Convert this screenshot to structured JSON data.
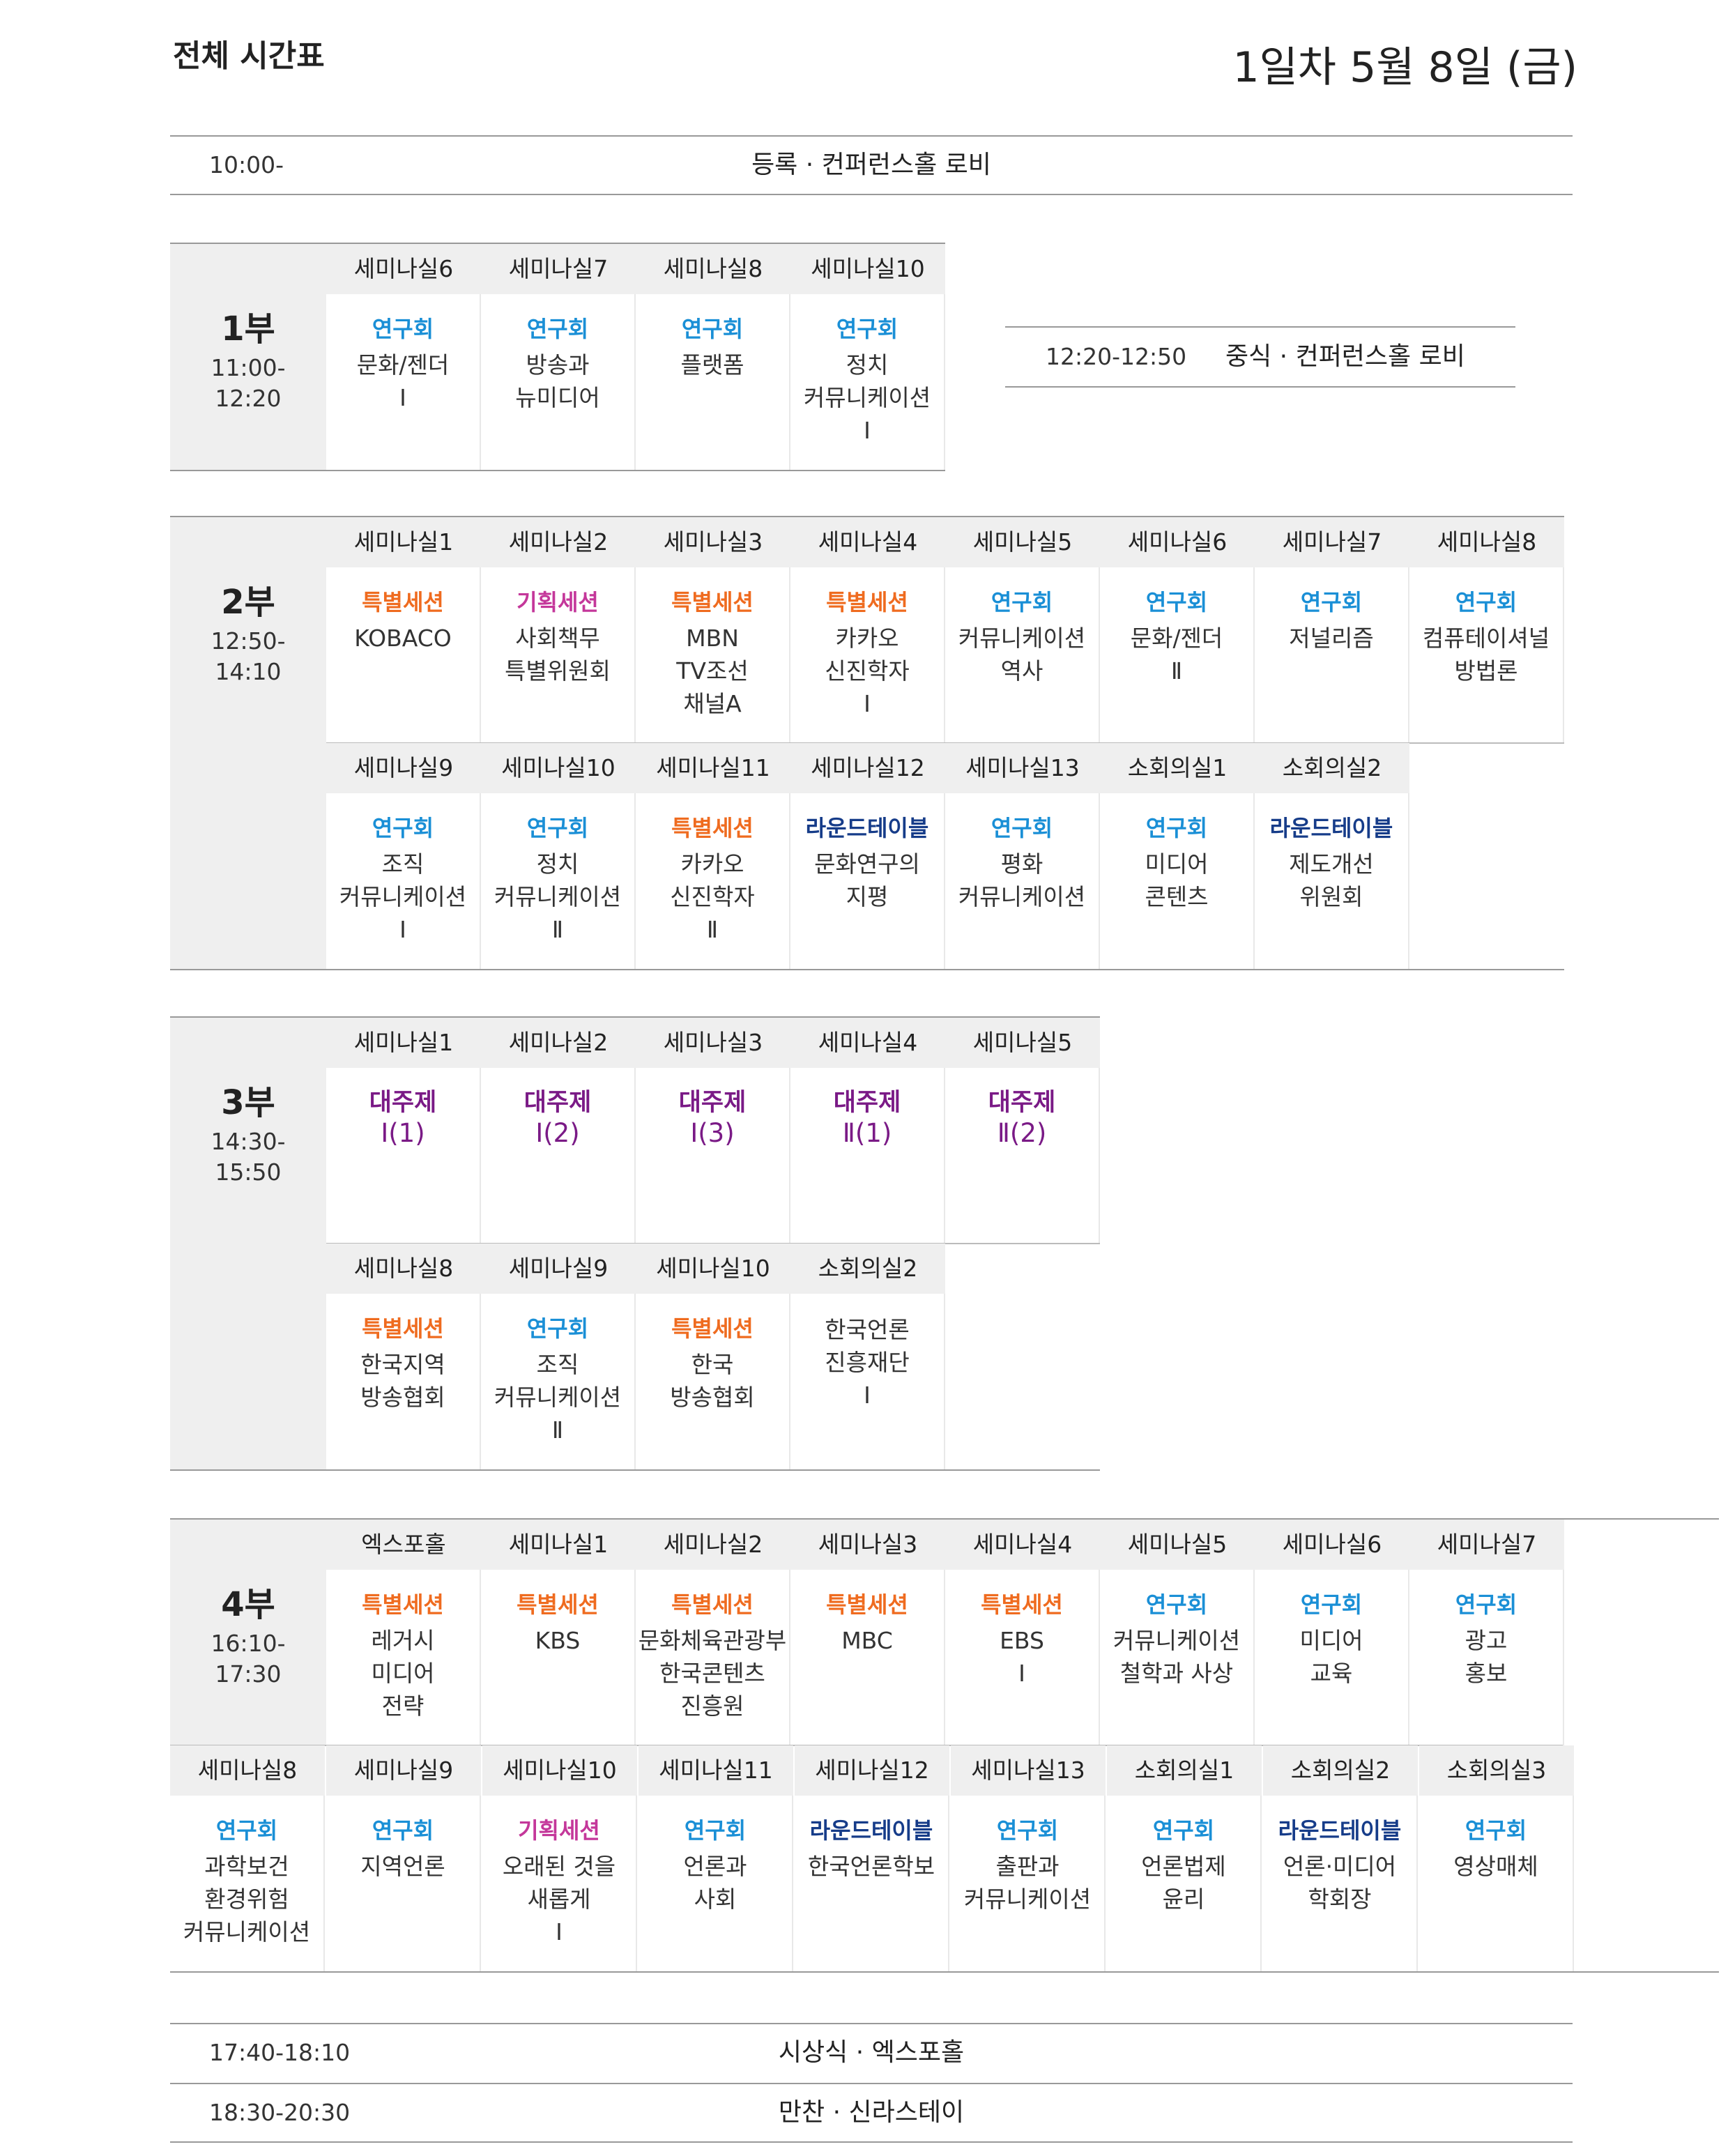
{
  "header": {
    "title": "전체 시간표",
    "date": "1일차 5월 8일 (금)"
  },
  "colors": {
    "study": "#1a8fd6",
    "special": "#ef6b1f",
    "planning": "#c4379a",
    "roundtable": "#163c89",
    "theme": "#7a1a86",
    "header_bg": "#efefef"
  },
  "registration": {
    "time": "10:00-",
    "event": "등록 · 컨퍼런스홀 로비"
  },
  "lunch": {
    "time": "12:20-12:50",
    "event": "중식 · 컨퍼런스홀 로비"
  },
  "parts": [
    {
      "name": "1부",
      "time_start": "11:00-",
      "time_end": "12:20",
      "rows": [
        [
          {
            "room": "세미나실6",
            "cat": "연구회",
            "lines": [
              "문화/젠더",
              "Ⅰ"
            ]
          },
          {
            "room": "세미나실7",
            "cat": "연구회",
            "lines": [
              "방송과",
              "뉴미디어"
            ]
          },
          {
            "room": "세미나실8",
            "cat": "연구회",
            "lines": [
              "플랫폼"
            ]
          },
          {
            "room": "세미나실10",
            "cat": "연구회",
            "lines": [
              "정치",
              "커뮤니케이션",
              "Ⅰ"
            ]
          }
        ]
      ]
    },
    {
      "name": "2부",
      "time_start": "12:50-",
      "time_end": "14:10",
      "rows": [
        [
          {
            "room": "세미나실1",
            "cat": "특별세션",
            "lines": [
              "KOBACO"
            ]
          },
          {
            "room": "세미나실2",
            "cat": "기획세션",
            "lines": [
              "사회책무",
              "특별위원회"
            ]
          },
          {
            "room": "세미나실3",
            "cat": "특별세션",
            "lines": [
              "MBN",
              "TV조선",
              "채널A"
            ]
          },
          {
            "room": "세미나실4",
            "cat": "특별세션",
            "lines": [
              "카카오",
              "신진학자",
              "Ⅰ"
            ]
          },
          {
            "room": "세미나실5",
            "cat": "연구회",
            "lines": [
              "커뮤니케이션",
              "역사"
            ]
          },
          {
            "room": "세미나실6",
            "cat": "연구회",
            "lines": [
              "문화/젠더",
              "Ⅱ"
            ]
          },
          {
            "room": "세미나실7",
            "cat": "연구회",
            "lines": [
              "저널리즘"
            ]
          },
          {
            "room": "세미나실8",
            "cat": "연구회",
            "lines": [
              "컴퓨테이셔널",
              "방법론"
            ]
          }
        ],
        [
          {
            "room": "세미나실9",
            "cat": "연구회",
            "lines": [
              "조직",
              "커뮤니케이션",
              "Ⅰ"
            ]
          },
          {
            "room": "세미나실10",
            "cat": "연구회",
            "lines": [
              "정치",
              "커뮤니케이션",
              "Ⅱ"
            ]
          },
          {
            "room": "세미나실11",
            "cat": "특별세션",
            "lines": [
              "카카오",
              "신진학자",
              "Ⅱ"
            ]
          },
          {
            "room": "세미나실12",
            "cat": "라운드테이블",
            "lines": [
              "문화연구의",
              "지평"
            ]
          },
          {
            "room": "세미나실13",
            "cat": "연구회",
            "lines": [
              "평화",
              "커뮤니케이션"
            ]
          },
          {
            "room": "소회의실1",
            "cat": "연구회",
            "lines": [
              "미디어",
              "콘텐츠"
            ]
          },
          {
            "room": "소회의실2",
            "cat": "라운드테이블",
            "lines": [
              "제도개선",
              "위원회"
            ]
          }
        ]
      ]
    },
    {
      "name": "3부",
      "time_start": "14:30-",
      "time_end": "15:50",
      "rows": [
        [
          {
            "room": "세미나실1",
            "cat": "대주제",
            "lines": [
              "Ⅰ(1)"
            ]
          },
          {
            "room": "세미나실2",
            "cat": "대주제",
            "lines": [
              "Ⅰ(2)"
            ]
          },
          {
            "room": "세미나실3",
            "cat": "대주제",
            "lines": [
              "Ⅰ(3)"
            ]
          },
          {
            "room": "세미나실4",
            "cat": "대주제",
            "lines": [
              "Ⅱ(1)"
            ]
          },
          {
            "room": "세미나실5",
            "cat": "대주제",
            "lines": [
              "Ⅱ(2)"
            ]
          }
        ],
        [
          {
            "room": "세미나실8",
            "cat": "특별세션",
            "lines": [
              "한국지역",
              "방송협회"
            ]
          },
          {
            "room": "세미나실9",
            "cat": "연구회",
            "lines": [
              "조직",
              "커뮤니케이션",
              "Ⅱ"
            ]
          },
          {
            "room": "세미나실10",
            "cat": "특별세션",
            "lines": [
              "한국",
              "방송협회"
            ]
          },
          {
            "room": "소회의실2",
            "cat": "",
            "lines": [
              "한국언론",
              "진흥재단",
              "Ⅰ"
            ]
          }
        ]
      ]
    },
    {
      "name": "4부",
      "time_start": "16:10-",
      "time_end": "17:30",
      "rows": [
        [
          {
            "room": "엑스포홀",
            "cat": "특별세션",
            "lines": [
              "레거시",
              "미디어",
              "전략"
            ]
          },
          {
            "room": "세미나실1",
            "cat": "특별세션",
            "lines": [
              "KBS"
            ]
          },
          {
            "room": "세미나실2",
            "cat": "특별세션",
            "lines": [
              "문화체육관광부",
              "한국콘텐츠",
              "진흥원"
            ]
          },
          {
            "room": "세미나실3",
            "cat": "특별세션",
            "lines": [
              "MBC"
            ]
          },
          {
            "room": "세미나실4",
            "cat": "특별세션",
            "lines": [
              "EBS",
              "Ⅰ"
            ]
          },
          {
            "room": "세미나실5",
            "cat": "연구회",
            "lines": [
              "커뮤니케이션",
              "철학과 사상"
            ]
          },
          {
            "room": "세미나실6",
            "cat": "연구회",
            "lines": [
              "미디어",
              "교육"
            ]
          },
          {
            "room": "세미나실7",
            "cat": "연구회",
            "lines": [
              "광고",
              "홍보"
            ]
          }
        ],
        [
          {
            "room": "세미나실8",
            "cat": "연구회",
            "lines": [
              "과학보건",
              "환경위험",
              "커뮤니케이션"
            ]
          },
          {
            "room": "세미나실9",
            "cat": "연구회",
            "lines": [
              "지역언론"
            ]
          },
          {
            "room": "세미나실10",
            "cat": "기획세션",
            "lines": [
              "오래된 것을",
              "새롭게",
              "Ⅰ"
            ]
          },
          {
            "room": "세미나실11",
            "cat": "연구회",
            "lines": [
              "언론과",
              "사회"
            ]
          },
          {
            "room": "세미나실12",
            "cat": "라운드테이블",
            "lines": [
              "한국언론학보"
            ]
          },
          {
            "room": "세미나실13",
            "cat": "연구회",
            "lines": [
              "출판과",
              "커뮤니케이션"
            ]
          },
          {
            "room": "소회의실1",
            "cat": "연구회",
            "lines": [
              "언론법제",
              "윤리"
            ]
          },
          {
            "room": "소회의실2",
            "cat": "라운드테이블",
            "lines": [
              "언론·미디어",
              "학회장"
            ]
          },
          {
            "room": "소회의실3",
            "cat": "연구회",
            "lines": [
              "영상매체"
            ]
          }
        ]
      ]
    }
  ],
  "awards": {
    "time": "17:40-18:10",
    "event": "시상식 · 엑스포홀"
  },
  "dinner": {
    "time": "18:30-20:30",
    "event": "만찬 · 신라스테이"
  }
}
